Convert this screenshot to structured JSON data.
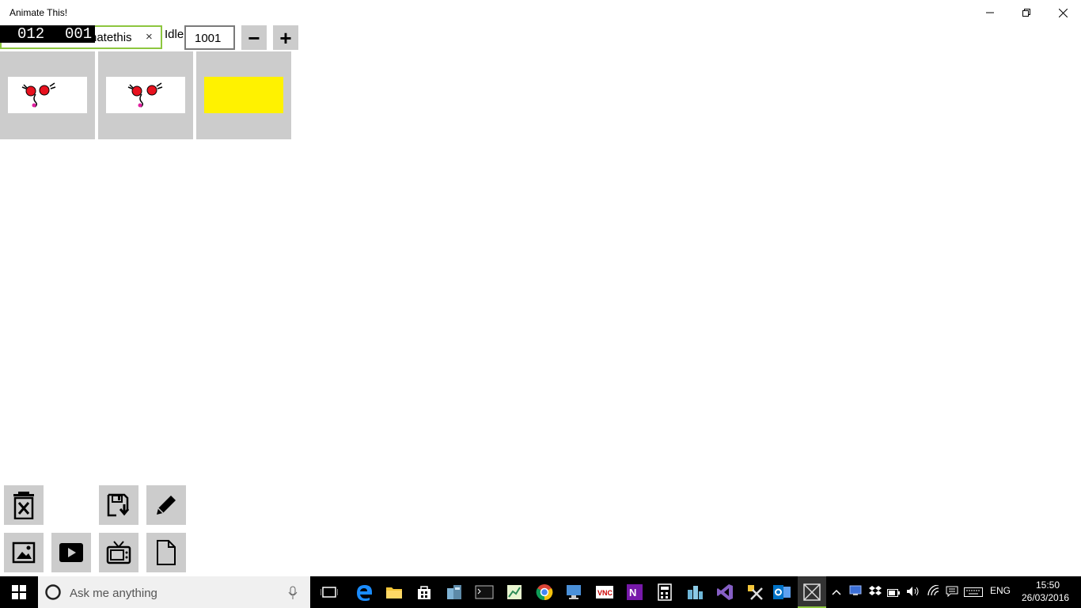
{
  "window": {
    "title": "Animate This!"
  },
  "controls": {
    "counter_left": "012",
    "counter_right": "001",
    "name_value": "natethis",
    "clear_symbol": "×",
    "idle_label": "Idle",
    "fps_value": "1001",
    "minus_symbol": "−",
    "plus_symbol": "+"
  },
  "frames": [
    {
      "kind": "image",
      "thumb_bg": "#ffffff"
    },
    {
      "kind": "image",
      "thumb_bg": "#ffffff"
    },
    {
      "kind": "color",
      "thumb_bg": "#fff200"
    }
  ],
  "tools": {
    "row1": [
      "delete-icon",
      "save-icon",
      "pencil-icon"
    ],
    "row2": [
      "image-icon",
      "play-icon",
      "tv-icon",
      "document-icon"
    ]
  },
  "taskbar": {
    "search_placeholder": "Ask me anything",
    "language": "ENG",
    "time": "15:50",
    "date": "26/03/2016"
  },
  "colors": {
    "accent_green": "#8dc63f",
    "button_gray": "#cccccc",
    "taskbar_active": "#8dc63f"
  }
}
